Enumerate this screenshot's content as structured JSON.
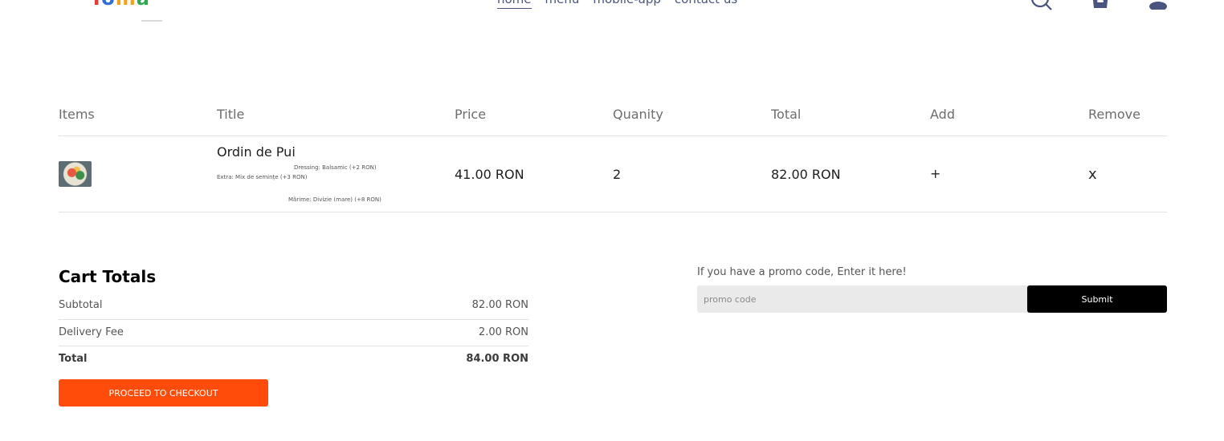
{
  "header": {
    "logo_parts": [
      "T",
      "o",
      "m",
      "a"
    ],
    "nav": [
      "home",
      "menu",
      "mobile-app",
      "contact us"
    ],
    "icons": [
      "search-icon",
      "basket-icon",
      "profile-icon"
    ]
  },
  "cart_table": {
    "headers": [
      "Items",
      "Title",
      "Price",
      "Quanity",
      "Total",
      "Add",
      "Remove"
    ],
    "items": [
      {
        "image": "food-thumbnail",
        "title": "Ordin de Pui",
        "options": [
          "Dressing: Balsamic (+2 RON)",
          "Extra: Mix de semințe (+3 RON)",
          "Mărime: Divizie (mare) (+8 RON)"
        ],
        "price": "41.00 RON",
        "quantity": "2",
        "total": "82.00 RON",
        "add_label": "+",
        "remove_label": "x"
      }
    ]
  },
  "cart_totals": {
    "title": "Cart Totals",
    "subtotal_label": "Subtotal",
    "subtotal_value": "82.00 RON",
    "delivery_label": "Delivery Fee",
    "delivery_value": "2.00 RON",
    "total_label": "Total",
    "total_value": "84.00 RON",
    "checkout_label": "PROCEED TO CHECKOUT"
  },
  "promo": {
    "label": "If you have a promo code, Enter it here!",
    "placeholder": "promo code",
    "submit_label": "Submit"
  },
  "colors": {
    "accent": "#ff4c0a",
    "nav": "#49557e",
    "submit": "#000000"
  }
}
